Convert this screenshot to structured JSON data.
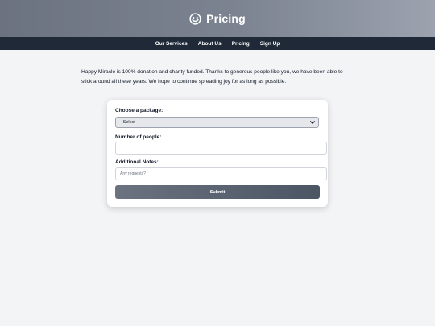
{
  "header": {
    "title": "Pricing",
    "icon": "smiley-icon"
  },
  "nav": {
    "items": [
      "Our Services",
      "About Us",
      "Pricing",
      "Sign Up"
    ]
  },
  "intro": "Happy Miracle is 100% donation and charity funded. Thanks to generous people like you, we have been able to stick around all these years. We hope to continue spreading joy for as long as possible.",
  "form": {
    "package_label": "Choose a package:",
    "package_selected": "--Select--",
    "people_label": "Number of people:",
    "people_value": "",
    "notes_label": "Additional Notes:",
    "notes_placeholder": "Any requests?",
    "submit_label": "Submit"
  }
}
